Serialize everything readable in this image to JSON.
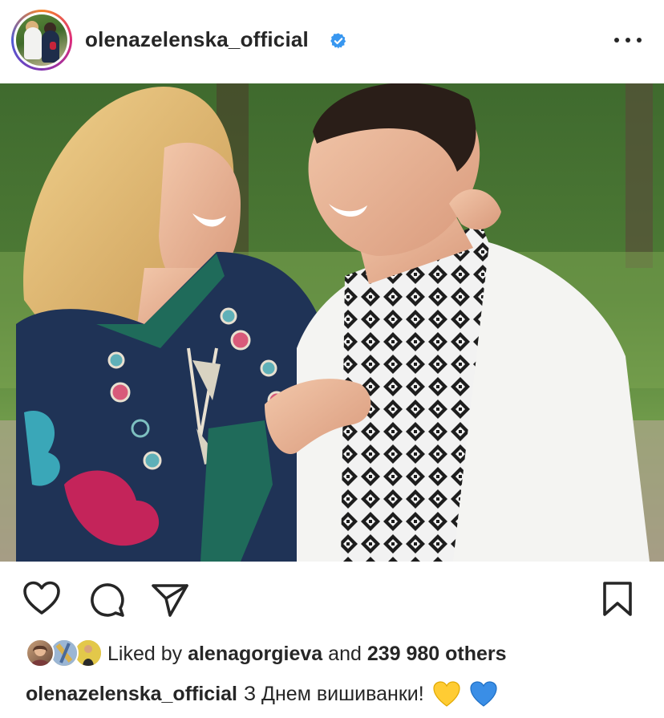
{
  "post": {
    "username": "olenazelenska_official",
    "verified": true,
    "more_icon": "more-horizontal-icon"
  },
  "actions": {
    "like_icon": "heart-outline-icon",
    "comment_icon": "comment-bubble-icon",
    "share_icon": "paper-plane-icon",
    "save_icon": "bookmark-icon"
  },
  "likes": {
    "prefix": "Liked by",
    "user": "alenagorgieva",
    "conjunction": "and",
    "count": "239 980 others"
  },
  "caption": {
    "username": "olenazelenska_official",
    "text": "З Днем вишиванки!",
    "emojis": [
      "yellow-heart",
      "blue-heart"
    ]
  },
  "colors": {
    "verified_blue": "#3897f0",
    "text": "#262626",
    "yellow_heart": "#ffcc33",
    "blue_heart": "#3a8ee6"
  }
}
